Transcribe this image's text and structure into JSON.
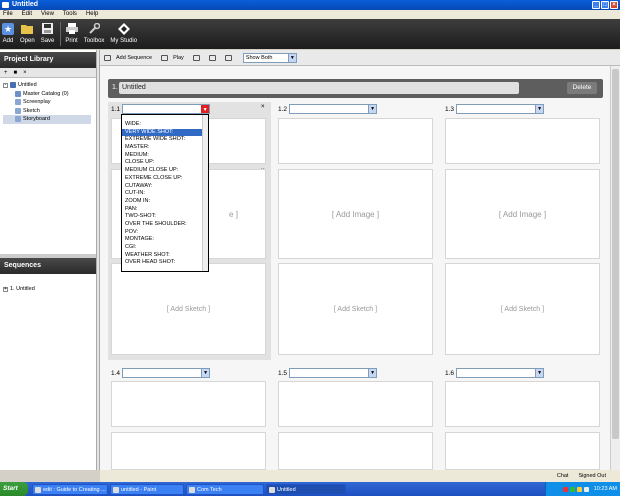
{
  "window": {
    "title": "Untitled",
    "min": "_",
    "max": "□",
    "close": "×"
  },
  "menu": [
    "File",
    "Edit",
    "View",
    "Tools",
    "Help"
  ],
  "toolbar": {
    "items": [
      {
        "label": "Add",
        "icon": "star-icon"
      },
      {
        "label": "Open",
        "icon": "folder-icon"
      },
      {
        "label": "Save",
        "icon": "disk-icon"
      },
      {
        "label": "Print",
        "icon": "printer-icon"
      },
      {
        "label": "Toolbox",
        "icon": "wrench-icon"
      },
      {
        "label": "My Studio",
        "icon": "diamond-icon"
      }
    ]
  },
  "project_library": {
    "title": "Project Library",
    "tree": [
      {
        "label": "Untitled",
        "level": 0,
        "expander": "-"
      },
      {
        "label": "Master Catalog (0)",
        "level": 1,
        "color": "#6f8fc7"
      },
      {
        "label": "Screenplay",
        "level": 1,
        "color": "#8aa7d1"
      },
      {
        "label": "Sketch",
        "level": 1,
        "color": "#8aa7d1"
      },
      {
        "label": "Storyboard",
        "level": 1,
        "color": "#8aa7d1",
        "selected": true
      }
    ]
  },
  "sequences": {
    "title": "Sequences",
    "items": [
      {
        "label": "1. Untitled",
        "expander": "+"
      }
    ]
  },
  "subtoolbar": {
    "add_sequence": "Add Sequence",
    "play": "Play",
    "view_select": "Show Both"
  },
  "sequence": {
    "number": "1.",
    "title": "Untitled",
    "delete_label": "Delete"
  },
  "shots": [
    {
      "id": "1.1",
      "image": "[ Add Image ]",
      "sketch": "[ Add Sketch ]"
    },
    {
      "id": "1.2",
      "image": "[ Add Image ]",
      "sketch": "[ Add Sketch ]"
    },
    {
      "id": "1.3",
      "image": "[ Add Image ]",
      "sketch": "[ Add Sketch ]"
    },
    {
      "id": "1.4"
    },
    {
      "id": "1.5"
    },
    {
      "id": "1.6"
    }
  ],
  "shot_dropdown": {
    "options": [
      "WIDE:",
      "VERY WIDE SHOT:",
      "EXTREME WIDE SHOT:",
      "MASTER:",
      "MEDIUM:",
      "CLOSE UP:",
      "MEDIUM CLOSE UP:",
      "EXTREME CLOSE UP:",
      "CUTAWAY:",
      "CUT-IN:",
      "ZOOM IN:",
      "PAN:",
      "TWO-SHOT:",
      "OVER THE SHOULDER:",
      "POV:",
      "MONTAGE:",
      "CGI:",
      "WEATHER SHOT:",
      "OVER HEAD SHOT:"
    ],
    "highlighted": "VERY WIDE SHOT:",
    "partial_image_text": "e ]"
  },
  "status": {
    "chat": "Chat",
    "signed": "Signed Out"
  },
  "taskbar": {
    "start": "Start",
    "tasks": [
      {
        "label": "edit : Guide to Creating ..."
      },
      {
        "label": "untitled - Paint"
      },
      {
        "label": "Com Tech"
      },
      {
        "label": "Untitled",
        "active": true
      }
    ],
    "clock": "10:23 AM"
  },
  "colors": {
    "titlebar": "#0a5fd8",
    "highlight": "#316ac5",
    "dark_header": "#2a2a2a",
    "taskbar": "#1e4fc2",
    "start": "#2a8a2a",
    "dropdown_arrow_border": "#e02020"
  }
}
